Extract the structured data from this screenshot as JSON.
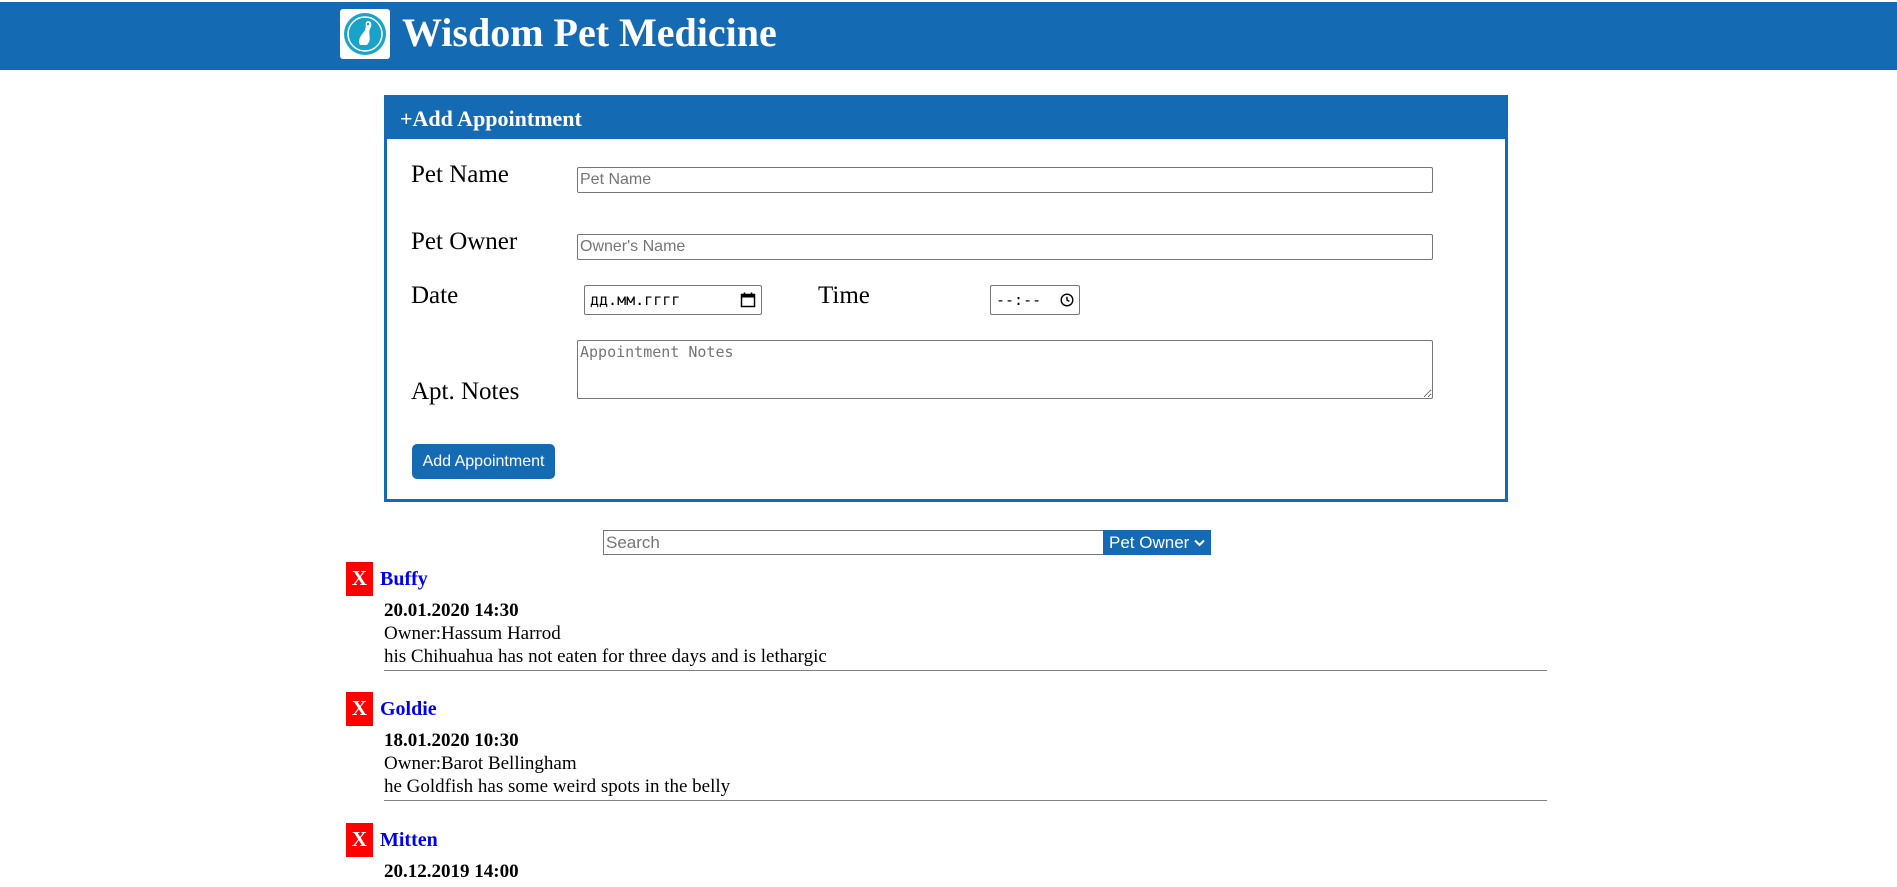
{
  "header": {
    "title": "Wisdom Pet Medicine",
    "bg_color": "#156ab4"
  },
  "add_form": {
    "heading": "+Add Appointment",
    "pet_name_label": "Pet Name",
    "pet_name_placeholder": "Pet Name",
    "pet_owner_label": "Pet Owner",
    "pet_owner_placeholder": "Owner's Name",
    "date_label": "Date",
    "date_placeholder": "дд.мм.гггг",
    "time_label": "Time",
    "time_placeholder": "--:--",
    "notes_label": "Apt. Notes",
    "notes_placeholder": "Appointment Notes",
    "submit_label": "Add Appointment"
  },
  "search": {
    "placeholder": "Search",
    "sort_label": "Pet Owner"
  },
  "appointments": [
    {
      "delete_label": "X",
      "pet_name": "Buffy",
      "date_time": "20.01.2020 14:30",
      "owner": "Owner:Hassum Harrod",
      "notes": "his Chihuahua has not eaten for three days and is lethargic"
    },
    {
      "delete_label": "X",
      "pet_name": "Goldie",
      "date_time": "18.01.2020 10:30",
      "owner": "Owner:Barot Bellingham",
      "notes": "he Goldfish has some weird spots in the belly"
    },
    {
      "delete_label": "X",
      "pet_name": "Mitten",
      "date_time": "20.12.2019 14:00",
      "owner": "",
      "notes": ""
    }
  ],
  "colors": {
    "accent": "#156ab4",
    "delete": "#ff0000",
    "pet_link": "#0000ee"
  }
}
